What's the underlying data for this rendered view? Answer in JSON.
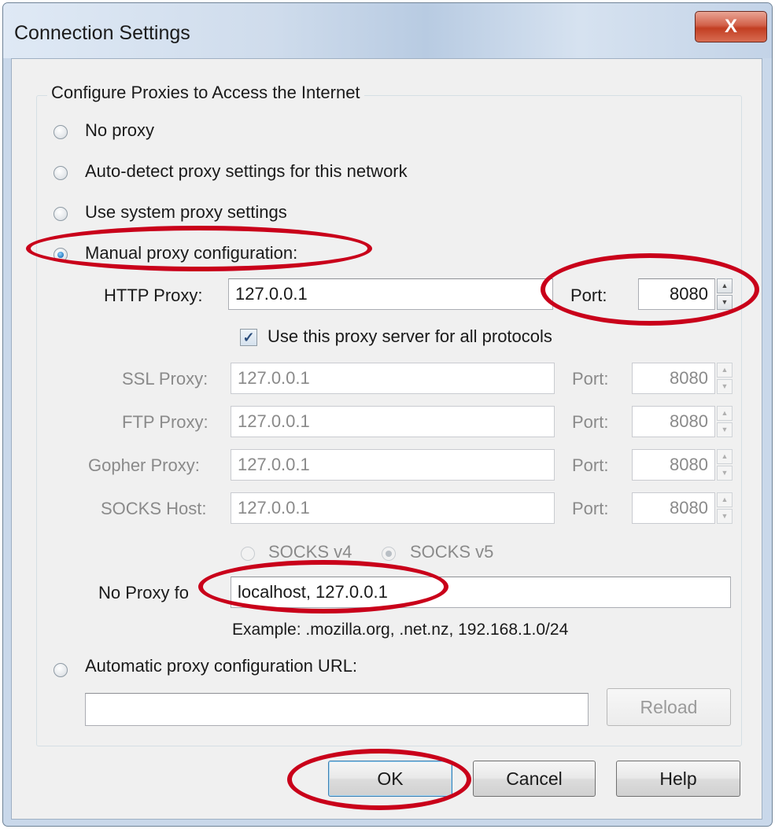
{
  "window": {
    "title": "Connection Settings",
    "close_glyph": "X",
    "close_icon": "close-icon"
  },
  "group": {
    "legend": "Configure Proxies to Access the Internet"
  },
  "proxy_options": {
    "no_proxy": {
      "label": "No proxy",
      "checked": false
    },
    "auto_detect": {
      "label": "Auto-detect proxy settings for this network",
      "checked": false
    },
    "system": {
      "label": "Use system proxy settings",
      "checked": false
    },
    "manual": {
      "label": "Manual proxy configuration:",
      "checked": true
    },
    "auto_url": {
      "label": "Automatic proxy configuration URL:",
      "checked": false
    }
  },
  "proxies": {
    "http": {
      "label": "HTTP Proxy:",
      "value": "127.0.0.1",
      "port_label": "Port:",
      "port": "8080"
    },
    "ssl": {
      "label": "SSL Proxy:",
      "value": "127.0.0.1",
      "port_label": "Port:",
      "port": "8080"
    },
    "ftp": {
      "label": "FTP Proxy:",
      "value": "127.0.0.1",
      "port_label": "Port:",
      "port": "8080"
    },
    "gopher": {
      "label": "Gopher Proxy:",
      "value": "127.0.0.1",
      "port_label": "Port:",
      "port": "8080"
    },
    "socks": {
      "label": "SOCKS Host:",
      "value": "127.0.0.1",
      "port_label": "Port:",
      "port": "8080"
    }
  },
  "use_for_all": {
    "label": "Use this proxy server for all protocols",
    "checked": true,
    "glyph": "✓"
  },
  "socks_version": {
    "v4": {
      "label": "SOCKS v4",
      "checked": false
    },
    "v5": {
      "label": "SOCKS v5",
      "checked": true
    }
  },
  "no_proxy_for": {
    "label": "No Proxy fo",
    "value": "localhost, 127.0.0.1",
    "example": "Example: .mozilla.org, .net.nz, 192.168.1.0/24"
  },
  "auto_config": {
    "url": "",
    "reload_label": "Reload"
  },
  "buttons": {
    "ok": "OK",
    "cancel": "Cancel",
    "help": "Help"
  },
  "spinner": {
    "up": "▲",
    "down": "▼"
  },
  "colors": {
    "highlight": "#c9001a",
    "accent": "#1b6fb8"
  }
}
